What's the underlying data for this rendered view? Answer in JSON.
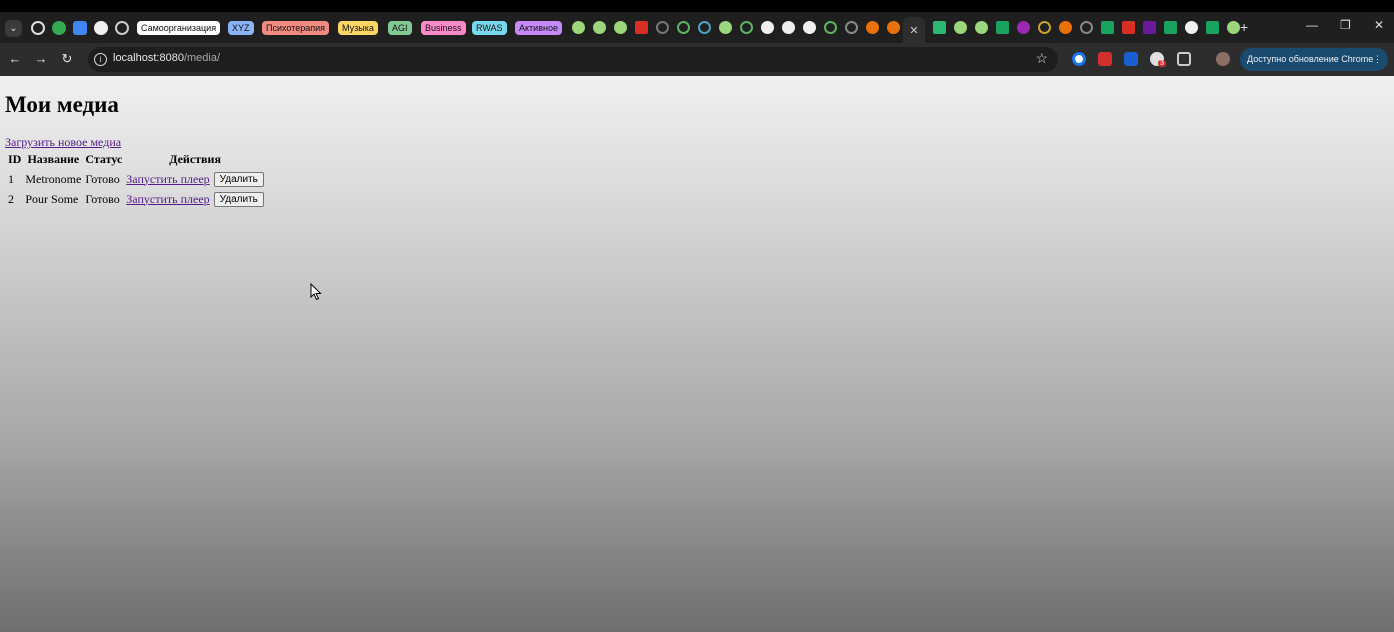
{
  "tab_groups": [
    {
      "label": "Самоорганизация",
      "color": "#ffffff"
    },
    {
      "label": "XYZ",
      "color": "#8ab4f8"
    },
    {
      "label": "Психотерапия",
      "color": "#f28b82"
    },
    {
      "label": "Музыка",
      "color": "#fdd663"
    },
    {
      "label": "AGI",
      "color": "#81c995"
    },
    {
      "label": "Business",
      "color": "#ff8bcb"
    },
    {
      "label": "RWAS",
      "color": "#78d9ec"
    },
    {
      "label": "Активное",
      "color": "#c58af9"
    }
  ],
  "browser": {
    "url_host": "localhost:8080",
    "url_path": "/media/",
    "update_label": "Доступно обновление Chrome",
    "ext_badge": "3"
  },
  "page": {
    "title": "Мои медиа",
    "upload_link": "Загрузить новое медиа",
    "table": {
      "headers": [
        "ID",
        "Название",
        "Статус",
        "Действия"
      ],
      "rows": [
        {
          "id": "1",
          "name": "Metronome",
          "status": "Готово",
          "play": "Запустить плеер",
          "delete": "Удалить"
        },
        {
          "id": "2",
          "name": "Pour Some",
          "status": "Готово",
          "play": "Запустить плеер",
          "delete": "Удалить"
        }
      ]
    }
  }
}
